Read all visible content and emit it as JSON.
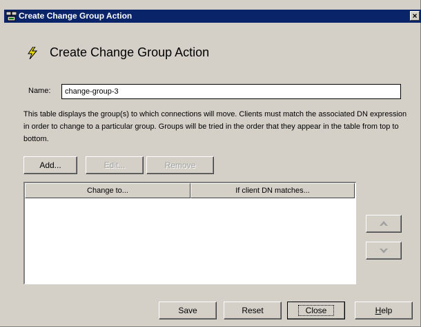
{
  "window": {
    "title": "Create Change Group Action",
    "close_glyph": "×",
    "icon": "directory-server-icon"
  },
  "heading": {
    "icon": "lightning-bolt-icon",
    "text": "Create Change Group Action"
  },
  "name_field": {
    "label": "Name:",
    "value": "change-group-3"
  },
  "description": "This table displays the group(s) to which connections will move.  Clients must match the associated DN expression in order to change to a particular group.  Groups will be tried in the order that they appear in the table from top to bottom.",
  "table_buttons": {
    "add": "Add...",
    "edit": "Edit...",
    "remove": "Remove"
  },
  "table": {
    "columns": [
      "Change to...",
      "If client DN matches..."
    ],
    "rows": []
  },
  "order_buttons": {
    "up_icon": "arrow-up-icon",
    "down_icon": "arrow-down-icon"
  },
  "footer_buttons": {
    "save": "Save",
    "reset": "Reset",
    "close": "Close",
    "help_mnemonic": "H",
    "help_rest": "elp"
  },
  "colors": {
    "titlebar": "#0a246a",
    "dialog_bg": "#d4d0c8",
    "bolt": "#e8d800"
  }
}
